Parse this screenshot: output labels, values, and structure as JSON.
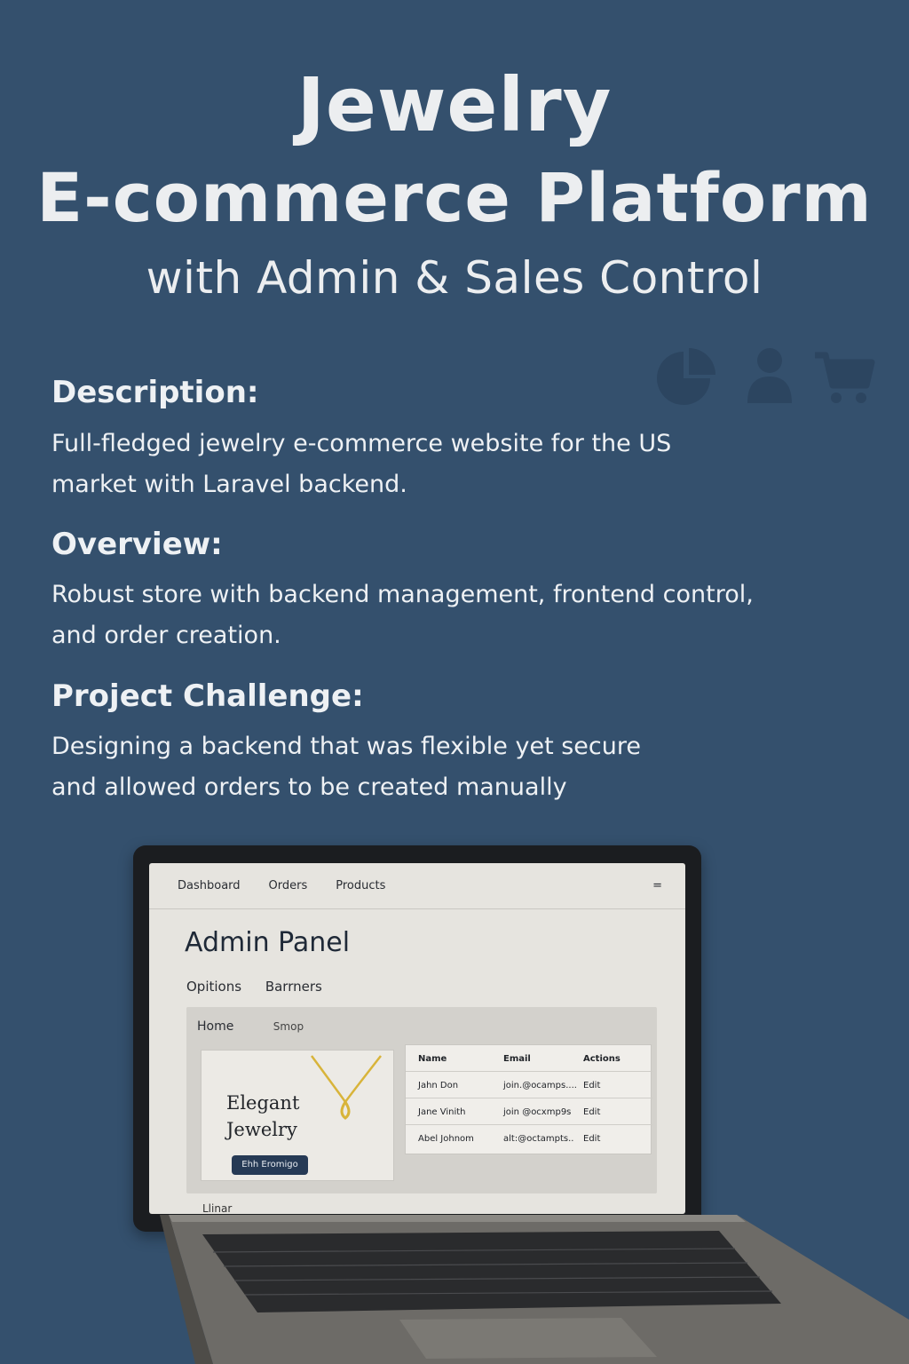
{
  "header": {
    "line1": "Jewelry",
    "line2": "E-commerce Platform",
    "line3": "with Admin & Sales Control"
  },
  "icons": [
    "pie-chart-icon",
    "user-icon",
    "cart-icon"
  ],
  "sections": [
    {
      "heading": "Description:",
      "lines": [
        "Full-fledged jewelry e-commerce website for the US",
        "market with Laravel backend."
      ]
    },
    {
      "heading": "Overview:",
      "lines": [
        "Robust store with backend management, frontend control,",
        "and order creation."
      ]
    },
    {
      "heading": "Project Challenge:",
      "lines": [
        "Designing a backend that was flexible yet secure",
        "and allowed orders to be created manually"
      ]
    }
  ],
  "laptop_screen": {
    "nav": [
      "Dashboard",
      "Orders",
      "Products"
    ],
    "menu_icon": "=",
    "title": "Admin Panel",
    "subtabs": [
      "Opitions",
      "Barrners"
    ],
    "panel_nav": [
      "Home",
      "Smop"
    ],
    "hero": {
      "line1": "Elegant",
      "line2": "Jewelry",
      "button": "Ehh Eromigo"
    },
    "table": {
      "headers": [
        "Name",
        "Email",
        "Actions"
      ],
      "rows": [
        [
          "Jahn Don",
          "join.@ocamps....",
          "Edit"
        ],
        [
          "Jane Vinith",
          "join @ocxmp9s",
          "Edit"
        ],
        [
          "Abel Johnom",
          "alt:@octampts..",
          "Edit"
        ]
      ]
    },
    "footer_text": "Llinar"
  },
  "colors": {
    "background": "#34506d",
    "icon": "#2c4560",
    "button": "#263a55",
    "necklace": "#d8b43a"
  }
}
